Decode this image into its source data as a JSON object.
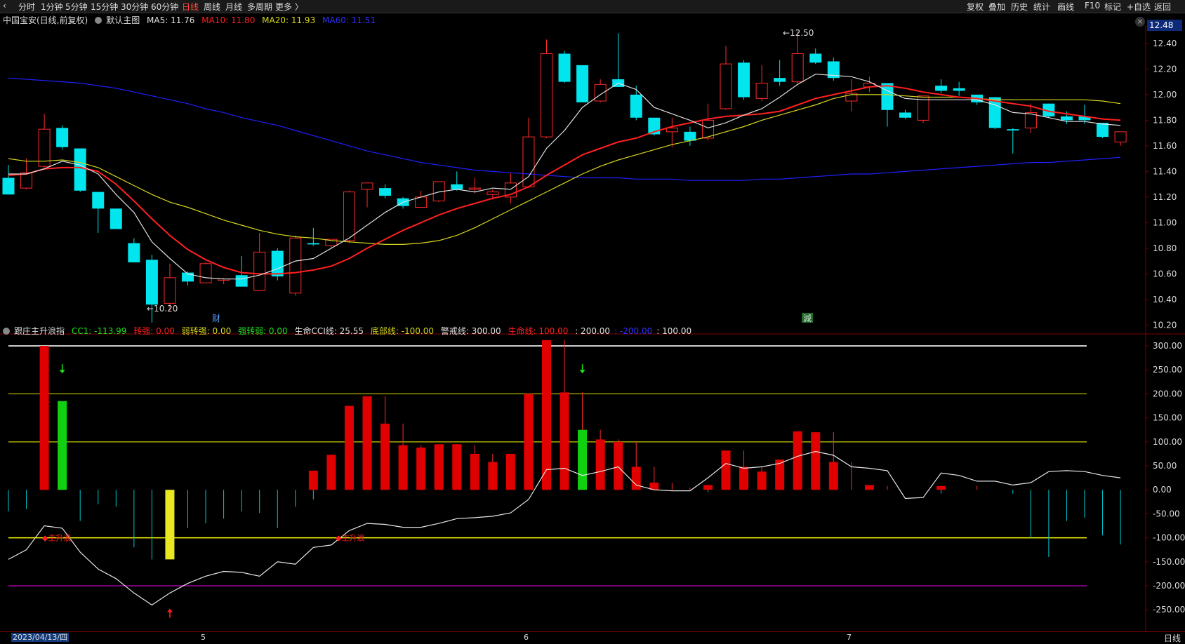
{
  "toolbar": {
    "left": [
      "分时",
      "1分钟",
      "5分钟",
      "15分钟",
      "30分钟",
      "60分钟",
      "日线",
      "周线",
      "月线",
      "多周期",
      "更多 〉"
    ],
    "active": "日线",
    "right": [
      "复权",
      "叠加",
      "历史",
      "统计",
      "画线",
      "F10",
      "标记",
      "+自选",
      "返回"
    ]
  },
  "main_header": {
    "stock": "中国宝安(日线,前复权)",
    "template": "默认主图",
    "ma5": "MA5: 11.76",
    "ma10": "MA10: 11.80",
    "ma20": "MA20: 11.93",
    "ma60": "MA60: 11.51"
  },
  "price_tag": "12.48",
  "indicator_header": {
    "name": "跟庄主升浪指",
    "cc1": "CC1: -113.99",
    "zq": "转强: 0.00",
    "rzq": "弱转强: 0.00",
    "qzr": "强转弱: 0.00",
    "cci": "生命CCI线: 25.55",
    "dbx": "底部线: -100.00",
    "jjx": "警戒线: 300.00",
    "smx": "生命线: 100.00",
    "v200": ": 200.00",
    "vm200": ": -200.00",
    "v100": ": 100.00"
  },
  "dates": {
    "first": "2023/04/13/四",
    "months": [
      "5",
      "6",
      "7"
    ]
  },
  "period": "日线",
  "annotations": {
    "high": "12.50",
    "low": "10.20",
    "tag_cai": "财",
    "tag_jian": "減",
    "zhushenglang": "主升浪"
  },
  "colors": {
    "up": "#ff2a2a",
    "down": "#00e5ee",
    "ma5": "#e0e0e0",
    "ma10": "#ff2020",
    "ma20": "#d8d820",
    "ma60": "#2020ff"
  },
  "chart_data": [
    {
      "type": "candlestick",
      "ylim": [
        10.12,
        12.52
      ],
      "yticks": [
        10.2,
        10.4,
        10.6,
        10.8,
        11.0,
        11.2,
        11.4,
        11.6,
        11.8,
        12.0,
        12.2,
        12.4
      ],
      "candles": [
        [
          11.35,
          11.45,
          11.22,
          11.22
        ],
        [
          11.27,
          11.5,
          11.26,
          11.39
        ],
        [
          11.44,
          11.85,
          11.43,
          11.73
        ],
        [
          11.74,
          11.76,
          11.57,
          11.59
        ],
        [
          11.58,
          11.58,
          11.24,
          11.25
        ],
        [
          11.24,
          11.24,
          10.92,
          11.11
        ],
        [
          11.11,
          11.11,
          10.96,
          10.95
        ],
        [
          10.84,
          10.88,
          10.69,
          10.69
        ],
        [
          10.71,
          10.75,
          10.22,
          10.36
        ],
        [
          10.37,
          10.68,
          10.31,
          10.57
        ],
        [
          10.61,
          10.62,
          10.51,
          10.54
        ],
        [
          10.53,
          10.69,
          10.53,
          10.68
        ],
        [
          10.55,
          10.57,
          10.52,
          10.56
        ],
        [
          10.59,
          10.74,
          10.52,
          10.5
        ],
        [
          10.47,
          10.92,
          10.47,
          10.77
        ],
        [
          10.78,
          10.8,
          10.55,
          10.58
        ],
        [
          10.45,
          10.9,
          10.43,
          10.88
        ],
        [
          10.84,
          10.96,
          10.82,
          10.83
        ],
        [
          10.82,
          10.87,
          10.8,
          10.87
        ],
        [
          10.86,
          11.25,
          10.84,
          11.24
        ],
        [
          11.26,
          11.28,
          11.12,
          11.31
        ],
        [
          11.27,
          11.3,
          11.19,
          11.21
        ],
        [
          11.19,
          11.2,
          11.11,
          11.13
        ],
        [
          11.12,
          11.25,
          11.12,
          11.2
        ],
        [
          11.17,
          11.3,
          11.16,
          11.32
        ],
        [
          11.3,
          11.4,
          11.25,
          11.26
        ],
        [
          11.26,
          11.35,
          11.23,
          11.27
        ],
        [
          11.22,
          11.26,
          11.18,
          11.24
        ],
        [
          11.2,
          11.39,
          11.15,
          11.31
        ],
        [
          11.28,
          11.82,
          11.27,
          11.67
        ],
        [
          11.67,
          12.43,
          11.66,
          12.32
        ],
        [
          12.32,
          12.34,
          12.09,
          12.1
        ],
        [
          12.23,
          12.23,
          11.94,
          11.94
        ],
        [
          11.95,
          12.12,
          11.94,
          12.08
        ],
        [
          12.12,
          12.48,
          12.07,
          12.06
        ],
        [
          12.0,
          12.07,
          11.8,
          11.82
        ],
        [
          11.82,
          11.82,
          11.68,
          11.69
        ],
        [
          11.71,
          11.82,
          11.59,
          11.74
        ],
        [
          11.71,
          11.75,
          11.6,
          11.64
        ],
        [
          11.66,
          11.93,
          11.64,
          11.8
        ],
        [
          11.89,
          12.38,
          11.88,
          12.24
        ],
        [
          12.25,
          12.27,
          11.96,
          11.98
        ],
        [
          11.97,
          12.23,
          11.95,
          12.09
        ],
        [
          12.13,
          12.27,
          12.07,
          12.1
        ],
        [
          12.1,
          12.5,
          12.09,
          12.32
        ],
        [
          12.32,
          12.36,
          12.24,
          12.25
        ],
        [
          12.26,
          12.29,
          12.11,
          12.13
        ],
        [
          11.95,
          12.12,
          11.87,
          12.01
        ],
        [
          12.06,
          12.14,
          12.02,
          12.09
        ],
        [
          12.09,
          12.08,
          11.75,
          11.88
        ],
        [
          11.86,
          11.88,
          11.81,
          11.82
        ],
        [
          11.8,
          11.99,
          11.78,
          11.99
        ],
        [
          12.07,
          12.12,
          12.01,
          12.03
        ],
        [
          12.05,
          12.1,
          11.99,
          12.03
        ],
        [
          12.0,
          12.0,
          11.92,
          11.94
        ],
        [
          11.98,
          11.98,
          11.73,
          11.74
        ],
        [
          11.73,
          11.74,
          11.54,
          11.72
        ],
        [
          11.74,
          11.93,
          11.7,
          11.86
        ],
        [
          11.93,
          11.93,
          11.82,
          11.83
        ],
        [
          11.83,
          11.87,
          11.77,
          11.8
        ],
        [
          11.83,
          11.92,
          11.77,
          11.8
        ],
        [
          11.78,
          11.78,
          11.66,
          11.67
        ],
        [
          11.63,
          11.71,
          11.6,
          11.71
        ]
      ],
      "ma5": [
        11.38,
        11.38,
        11.42,
        11.48,
        11.45,
        11.38,
        11.22,
        11.08,
        10.85,
        10.72,
        10.6,
        10.57,
        10.56,
        10.56,
        10.59,
        10.64,
        10.7,
        10.72,
        10.8,
        10.88,
        10.98,
        11.08,
        11.16,
        11.2,
        11.24,
        11.26,
        11.24,
        11.27,
        11.26,
        11.36,
        11.58,
        11.72,
        11.9,
        12.0,
        12.09,
        12.04,
        11.9,
        11.85,
        11.8,
        11.74,
        11.78,
        11.84,
        11.89,
        11.98,
        12.08,
        12.16,
        12.15,
        12.14,
        12.1,
        12.03,
        11.97,
        11.96,
        11.96,
        11.96,
        11.96,
        11.92,
        11.86,
        11.85,
        11.82,
        11.79,
        11.79,
        11.77,
        11.76
      ],
      "ma10": [
        11.37,
        11.38,
        11.42,
        11.43,
        11.43,
        11.4,
        11.3,
        11.17,
        11.03,
        10.9,
        10.79,
        10.71,
        10.65,
        10.61,
        10.6,
        10.6,
        10.61,
        10.63,
        10.66,
        10.72,
        10.8,
        10.87,
        10.94,
        11.0,
        11.06,
        11.11,
        11.15,
        11.19,
        11.22,
        11.28,
        11.37,
        11.45,
        11.53,
        11.58,
        11.63,
        11.66,
        11.71,
        11.75,
        11.78,
        11.81,
        11.83,
        11.84,
        11.85,
        11.87,
        11.92,
        11.97,
        12.0,
        12.03,
        12.06,
        12.07,
        12.05,
        12.02,
        12.0,
        11.98,
        11.97,
        11.95,
        11.93,
        11.91,
        11.87,
        11.85,
        11.83,
        11.81,
        11.8
      ],
      "ma20": [
        11.5,
        11.48,
        11.48,
        11.49,
        11.47,
        11.43,
        11.36,
        11.29,
        11.22,
        11.16,
        11.12,
        11.07,
        11.02,
        10.98,
        10.94,
        10.91,
        10.89,
        10.88,
        10.86,
        10.85,
        10.84,
        10.83,
        10.83,
        10.84,
        10.86,
        10.9,
        10.96,
        11.03,
        11.1,
        11.17,
        11.24,
        11.31,
        11.38,
        11.44,
        11.49,
        11.53,
        11.57,
        11.61,
        11.64,
        11.67,
        11.71,
        11.75,
        11.8,
        11.84,
        11.88,
        11.92,
        11.97,
        12.0,
        12.0,
        12.0,
        11.99,
        11.98,
        11.98,
        11.98,
        11.97,
        11.96,
        11.96,
        11.96,
        11.96,
        11.96,
        11.96,
        11.95,
        11.93
      ],
      "ma60": [
        12.13,
        12.12,
        12.11,
        12.1,
        12.09,
        12.07,
        12.05,
        12.02,
        11.99,
        11.96,
        11.93,
        11.89,
        11.86,
        11.82,
        11.79,
        11.76,
        11.72,
        11.68,
        11.64,
        11.6,
        11.56,
        11.53,
        11.5,
        11.47,
        11.45,
        11.43,
        11.41,
        11.4,
        11.39,
        11.38,
        11.37,
        11.36,
        11.35,
        11.35,
        11.35,
        11.34,
        11.34,
        11.34,
        11.33,
        11.33,
        11.33,
        11.33,
        11.34,
        11.34,
        11.35,
        11.36,
        11.37,
        11.38,
        11.38,
        11.39,
        11.4,
        11.41,
        11.42,
        11.43,
        11.44,
        11.45,
        11.46,
        11.47,
        11.47,
        11.48,
        11.49,
        11.5,
        11.51
      ]
    },
    {
      "type": "bar",
      "ylim": [
        -295,
        322
      ],
      "yticks": [
        300,
        250,
        200,
        150,
        100,
        50,
        0,
        -50,
        -100,
        -150,
        -200,
        -250
      ],
      "reflines": [
        {
          "value": 300,
          "color": "#ffffff"
        },
        {
          "value": 200,
          "color": "#c8c800"
        },
        {
          "value": 100,
          "color": "#c8c800"
        },
        {
          "value": -100,
          "color": "#ffff00"
        },
        {
          "value": -200,
          "color": "#c000c0"
        }
      ],
      "cc1": [
        -45,
        -40,
        300,
        185,
        -65,
        -30,
        -35,
        -120,
        -145,
        -50,
        -80,
        -70,
        -60,
        -45,
        -48,
        -80,
        -35,
        -20,
        40,
        72,
        175,
        195,
        138,
        93,
        88,
        95,
        93,
        75,
        58,
        75,
        200,
        312,
        203,
        125,
        105,
        100,
        48,
        15,
        5,
        -5,
        8,
        82,
        48,
        48,
        63,
        120,
        120,
        58,
        0,
        8,
        0,
        0,
        -8,
        0,
        8,
        0,
        -8,
        -100,
        -140,
        -65,
        -58,
        -95,
        -113.99
      ],
      "bars": [
        {
          "i": 2,
          "v": 300,
          "c": "red"
        },
        {
          "i": 3,
          "v": 185,
          "c": "green"
        },
        {
          "i": 9,
          "v": -145,
          "c": "yellow"
        },
        {
          "i": 17,
          "v": 40,
          "c": "red"
        },
        {
          "i": 18,
          "v": 73,
          "c": "red"
        },
        {
          "i": 19,
          "v": 175,
          "c": "red"
        },
        {
          "i": 20,
          "v": 195,
          "c": "red"
        },
        {
          "i": 21,
          "v": 138,
          "c": "red"
        },
        {
          "i": 22,
          "v": 93,
          "c": "red"
        },
        {
          "i": 23,
          "v": 88,
          "c": "red"
        },
        {
          "i": 24,
          "v": 95,
          "c": "red"
        },
        {
          "i": 25,
          "v": 95,
          "c": "red"
        },
        {
          "i": 26,
          "v": 75,
          "c": "red"
        },
        {
          "i": 27,
          "v": 58,
          "c": "red"
        },
        {
          "i": 28,
          "v": 75,
          "c": "red"
        },
        {
          "i": 29,
          "v": 200,
          "c": "red"
        },
        {
          "i": 30,
          "v": 312,
          "c": "red"
        },
        {
          "i": 31,
          "v": 203,
          "c": "red"
        },
        {
          "i": 32,
          "v": 125,
          "c": "green"
        },
        {
          "i": 33,
          "v": 105,
          "c": "red"
        },
        {
          "i": 34,
          "v": 100,
          "c": "red"
        },
        {
          "i": 35,
          "v": 48,
          "c": "red"
        },
        {
          "i": 36,
          "v": 15,
          "c": "red"
        },
        {
          "i": 39,
          "v": 10,
          "c": "red"
        },
        {
          "i": 40,
          "v": 82,
          "c": "red"
        },
        {
          "i": 41,
          "v": 48,
          "c": "red"
        },
        {
          "i": 42,
          "v": 38,
          "c": "red"
        },
        {
          "i": 43,
          "v": 63,
          "c": "red"
        },
        {
          "i": 44,
          "v": 122,
          "c": "red"
        },
        {
          "i": 45,
          "v": 120,
          "c": "red"
        },
        {
          "i": 46,
          "v": 58,
          "c": "red"
        },
        {
          "i": 48,
          "v": 10,
          "c": "red"
        },
        {
          "i": 52,
          "v": 8,
          "c": "red"
        }
      ],
      "cci": [
        -145,
        -125,
        -75,
        -80,
        -130,
        -165,
        -185,
        -215,
        -240,
        -215,
        -195,
        -180,
        -170,
        -172,
        -180,
        -150,
        -155,
        -120,
        -115,
        -85,
        -70,
        -72,
        -78,
        -78,
        -70,
        -60,
        -58,
        -55,
        -48,
        -20,
        42,
        45,
        30,
        38,
        48,
        10,
        0,
        -2,
        -2,
        25,
        55,
        45,
        48,
        55,
        70,
        80,
        72,
        48,
        45,
        40,
        -18,
        -16,
        35,
        30,
        18,
        18,
        10,
        15,
        38,
        40,
        38,
        30,
        25
      ],
      "arrows": [
        {
          "i": 3,
          "dir": "down",
          "c": "green"
        },
        {
          "i": 32,
          "dir": "down",
          "c": "green"
        },
        {
          "i": 9,
          "dir": "up",
          "c": "red"
        }
      ]
    }
  ]
}
